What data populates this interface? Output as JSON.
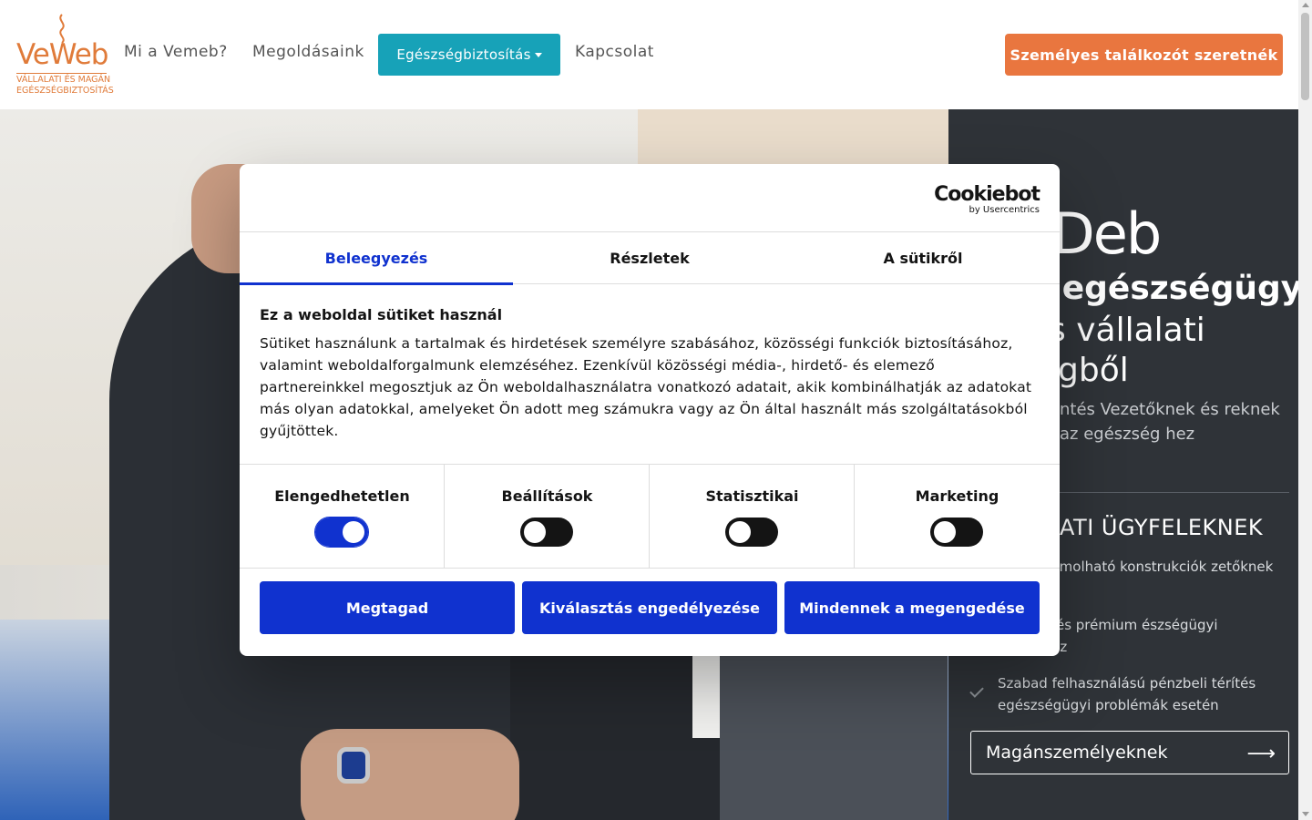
{
  "logo": {
    "brand": "VeWeb",
    "tagline_1": "VÁLLALATI ÉS MAGÁN",
    "tagline_2": "EGÉSZSÉGBIZTOSÍTÁS"
  },
  "nav": {
    "items": [
      {
        "label": "Mi a Vemeb?"
      },
      {
        "label": "Megoldásaink"
      },
      {
        "label": "Egészségbiztosítás"
      },
      {
        "label": "Kapcsolat"
      }
    ],
    "cta": "Személyes találkozót szeretnék"
  },
  "hero": {
    "logo_fragment": "Ɗeb",
    "heading_1": "t egészségügyi",
    "heading_2": "s vállalati",
    "heading_3": "gből",
    "subtitle": "ntés Vezetőknek és reknek az egészség hez",
    "section_title": "ATI ÜGYFELEKNEK",
    "features": [
      "ent elszámolható konstrukciók zetőknek",
      "hozzáférés prémium észségügyi ellátáshoz",
      "Szabad felhasználású pénzbeli térítés egészségügyi problémák esetén"
    ],
    "private_button": "Magánszemélyeknek",
    "arrow": "⟶"
  },
  "cookie": {
    "brand": "Cookiebot",
    "brand_sub": "by Usercentrics",
    "tabs": [
      {
        "label": "Beleegyezés",
        "active": true
      },
      {
        "label": "Részletek",
        "active": false
      },
      {
        "label": "A sütikről",
        "active": false
      }
    ],
    "title": "Ez a weboldal sütiket használ",
    "text": "Sütiket használunk a tartalmak és hirdetések személyre szabásához, közösségi funkciók biztosításához, valamint weboldalforgalmunk elemzéséhez. Ezenkívül közösségi média-, hirdető- és elemező partnereinkkel megosztjuk az Ön weboldalhasználatra vonatkozó adatait, akik kombinálhatják az adatokat más olyan adatokkal, amelyeket Ön adott meg számukra vagy az Ön által használt más szolgáltatásokból gyűjtöttek.",
    "toggles": [
      {
        "label": "Elengedhetetlen",
        "on": true
      },
      {
        "label": "Beállítások",
        "on": false
      },
      {
        "label": "Statisztikai",
        "on": false
      },
      {
        "label": "Marketing",
        "on": false
      }
    ],
    "buttons": {
      "deny": "Megtagad",
      "allow_selection": "Kiválasztás engedélyezése",
      "allow_all": "Mindennek a megengedése"
    }
  },
  "colors": {
    "accent_blue": "#1032cf",
    "teal": "#17a2b8",
    "orange": "#e9763f",
    "dark_panel": "#2f3338"
  }
}
